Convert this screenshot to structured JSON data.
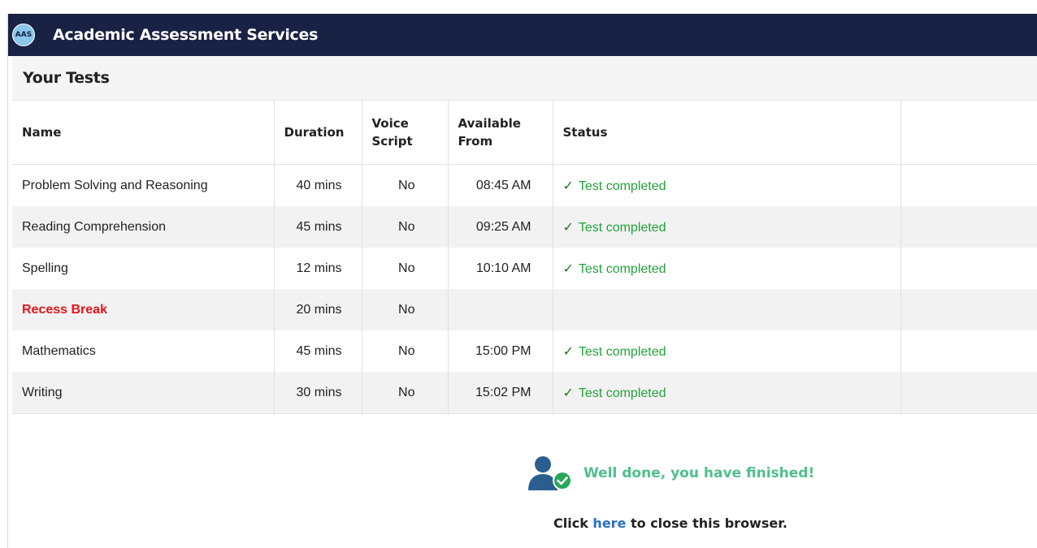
{
  "header": {
    "logo_text": "AAS",
    "title": "Academic Assessment Services"
  },
  "section": {
    "title": "Your Tests"
  },
  "table": {
    "columns": {
      "name": "Name",
      "duration": "Duration",
      "voice_line1": "Voice",
      "voice_line2": "Script",
      "avail_line1": "Available",
      "avail_line2": "From",
      "status": "Status"
    },
    "rows": [
      {
        "name": "Problem Solving and Reasoning",
        "duration": "40 mins",
        "voice": "No",
        "available": "08:45 AM",
        "status": "Test completed"
      },
      {
        "name": "Reading Comprehension",
        "duration": "45 mins",
        "voice": "No",
        "available": "09:25 AM",
        "status": "Test completed"
      },
      {
        "name": "Spelling",
        "duration": "12 mins",
        "voice": "No",
        "available": "10:10 AM",
        "status": "Test completed"
      },
      {
        "name": "Recess Break",
        "duration": "20 mins",
        "voice": "No",
        "available": "",
        "status": ""
      },
      {
        "name": "Mathematics",
        "duration": "45 mins",
        "voice": "No",
        "available": "15:00 PM",
        "status": "Test completed"
      },
      {
        "name": "Writing",
        "duration": "30 mins",
        "voice": "No",
        "available": "15:02 PM",
        "status": "Test completed"
      }
    ]
  },
  "finish": {
    "message": "Well done, you have finished!",
    "close_prefix": "Click",
    "close_link": "here",
    "close_suffix": "to close this browser."
  },
  "colors": {
    "topbar": "#192244",
    "status_green": "#22a33a",
    "break_red": "#e8141b",
    "finish_green": "#4fbf8c",
    "link_blue": "#2a6ebd"
  },
  "icons": {
    "status": "check-icon",
    "finish": "user-check-icon"
  }
}
